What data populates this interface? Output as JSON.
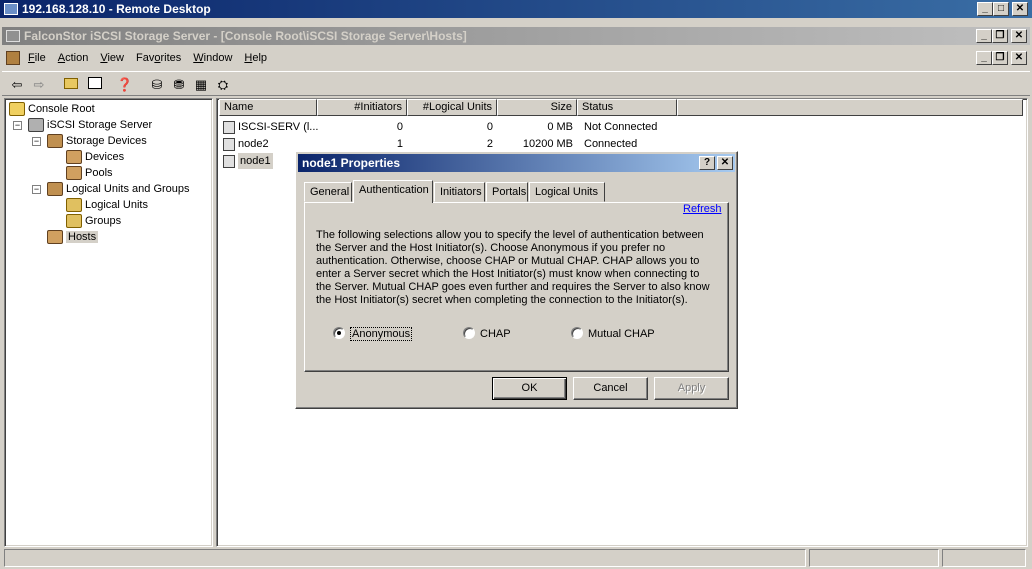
{
  "rdp": {
    "title": "192.168.128.10 - Remote Desktop"
  },
  "app": {
    "title": "FalconStor iSCSI Storage Server - [Console Root\\iSCSI Storage Server\\Hosts]"
  },
  "menu": [
    {
      "label": "File",
      "key": "F"
    },
    {
      "label": "Action",
      "key": "A"
    },
    {
      "label": "View",
      "key": "V"
    },
    {
      "label": "Favorites",
      "key": "o"
    },
    {
      "label": "Window",
      "key": "W"
    },
    {
      "label": "Help",
      "key": "H"
    }
  ],
  "toolbar_icons": [
    "back-arrow-icon",
    "forward-arrow-icon",
    "up-folder-icon",
    "show-hide-tree-icon",
    "help-icon",
    "server-icon",
    "disk-icon",
    "properties-icon",
    "console-icon"
  ],
  "tree": {
    "root": "Console Root",
    "server": "iSCSI Storage Server",
    "storage_devices": "Storage Devices",
    "devices": "Devices",
    "pools": "Pools",
    "lug": "Logical Units and Groups",
    "logical_units": "Logical Units",
    "groups": "Groups",
    "hosts": "Hosts"
  },
  "list": {
    "headers": [
      "Name",
      "#Initiators",
      "#Logical Units",
      "Size",
      "Status"
    ],
    "rows": [
      {
        "name": "ISCSI-SERV (l...",
        "initiators": "0",
        "luns": "0",
        "size": "0 MB",
        "status": "Not Connected"
      },
      {
        "name": "node2",
        "initiators": "1",
        "luns": "2",
        "size": "10200 MB",
        "status": "Connected"
      },
      {
        "name": "node1",
        "initiators": "",
        "luns": "",
        "size": "",
        "status": ""
      }
    ]
  },
  "dialog": {
    "title": "node1 Properties",
    "help_btn": "?",
    "close_btn": "✕",
    "tabs": [
      "General",
      "Authentication",
      "Initiators",
      "Portals",
      "Logical Units"
    ],
    "active_tab": "Authentication",
    "refresh": "Refresh",
    "description": "The following selections allow you to specify the level of authentication between the Server and the Host Initiator(s).  Choose Anonymous if you prefer no authentication. Otherwise, choose CHAP or Mutual CHAP.  CHAP allows you to enter a Server secret which the Host Initiator(s) must know when connecting to the Server.  Mutual CHAP goes even further and requires the Server to also know the Host Initiator(s) secret when completing the connection to the Initiator(s).",
    "options": [
      {
        "label": "Anonymous",
        "selected": true
      },
      {
        "label": "CHAP",
        "selected": false
      },
      {
        "label": "Mutual CHAP",
        "selected": false
      }
    ],
    "ok": "OK",
    "cancel": "Cancel",
    "apply": "Apply"
  }
}
